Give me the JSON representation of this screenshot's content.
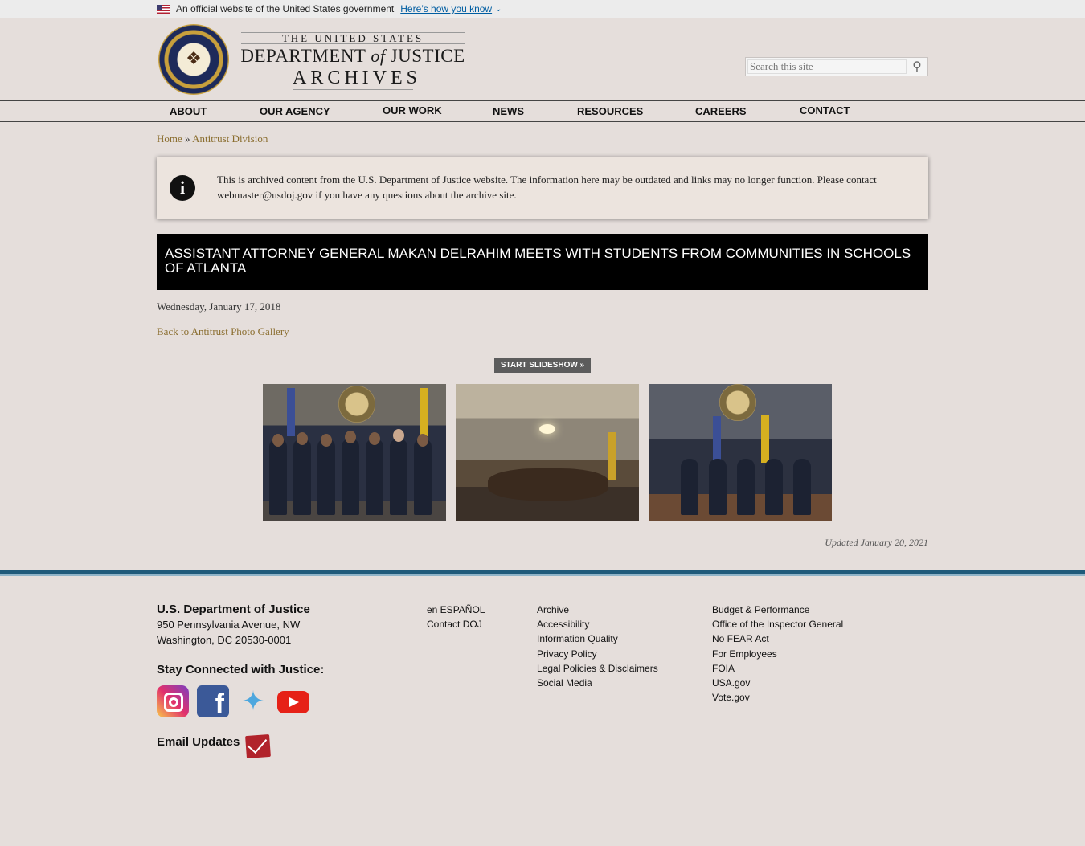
{
  "gov_banner": {
    "text": "An official website of the United States government",
    "link": "Here’s how you know"
  },
  "header": {
    "logo_line1": "THE UNITED STATES",
    "logo_line2a": "DEPARTMENT",
    "logo_line2b": "of",
    "logo_line2c": "JUSTICE",
    "logo_line3": "ARCHIVES",
    "search_placeholder": "Search this site",
    "search_icon": "magnifier-icon"
  },
  "nav": {
    "items": [
      "ABOUT",
      "OUR AGENCY",
      "OUR WORK",
      "NEWS",
      "RESOURCES",
      "CAREERS",
      "CONTACT"
    ]
  },
  "breadcrumb": {
    "home": "Home",
    "sep": "»",
    "current": "Antitrust Division"
  },
  "notice": {
    "icon": "info-icon",
    "text": "This is archived content from the U.S. Department of Justice website. The information here may be outdated and links may no longer function. Please contact webmaster@usdoj.gov if you have any questions about the archive site."
  },
  "article": {
    "title": "Assistant Attorney General Makan Delrahim Meets with Students from Communities in Schools of Atlanta",
    "date": "Wednesday, January 17, 2018",
    "back_link": "Back to Antitrust Photo Gallery",
    "slideshow_label": "START SLIDESHOW »",
    "updated": "Updated January 20, 2021"
  },
  "footer": {
    "org": "U.S. Department of Justice",
    "addr1": "950 Pennsylvania Avenue, NW",
    "addr2": "Washington, DC 20530-0001",
    "stay_connected": "Stay Connected with Justice:",
    "email_updates": "Email Updates",
    "social": [
      "instagram-icon",
      "facebook-icon",
      "twitter-icon",
      "youtube-icon"
    ],
    "col1": [
      "en ESPAÑOL",
      "Contact DOJ"
    ],
    "col2": [
      "Archive",
      "Accessibility",
      "Information Quality",
      "Privacy Policy",
      "Legal Policies & Disclaimers",
      "Social Media"
    ],
    "col3": [
      "Budget & Performance",
      "Office of the Inspector General",
      "No FEAR Act",
      "For Employees",
      "FOIA",
      "USA.gov",
      "Vote.gov"
    ]
  },
  "colors": {
    "page_bg": "#e5dedb",
    "link_gold": "#8a6d2e",
    "gov_link_blue": "#005ea2",
    "footer_rule": "#1f5a7a",
    "title_bar": "#000000"
  }
}
